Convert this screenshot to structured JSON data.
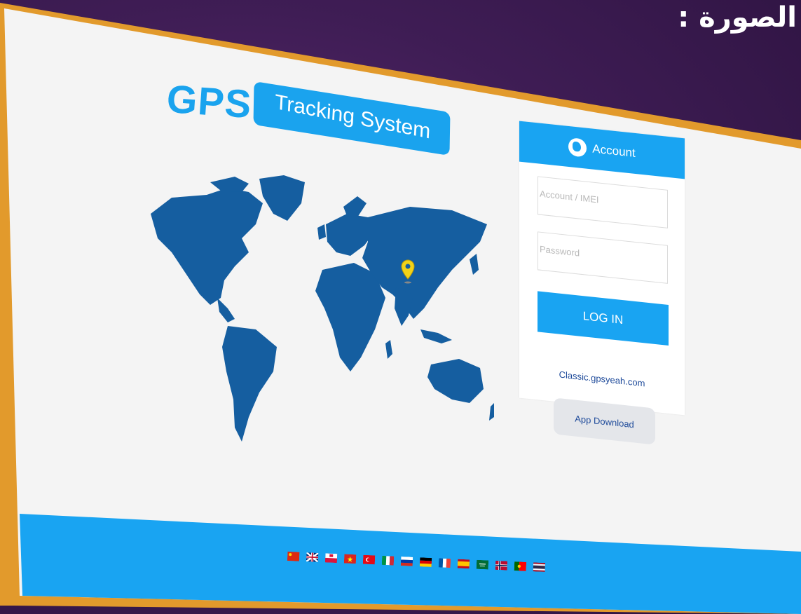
{
  "caption": "الصورة :",
  "logo": {
    "gps": "GPS",
    "tagline": "Tracking System"
  },
  "login": {
    "header": "Account",
    "account_placeholder": "Account / IMEI",
    "password_placeholder": "Password",
    "login_button": "LOG IN",
    "classic_link": "Classic.gpsyeah.com",
    "app_download": "App Download"
  },
  "map": {
    "marker_icon": "location-pin-icon"
  },
  "languages": [
    "flag-china-icon",
    "flag-uk-icon",
    "flag-poland-icon",
    "flag-vietnam-icon",
    "flag-turkey-icon",
    "flag-italy-icon",
    "flag-russia-icon",
    "flag-germany-icon",
    "flag-france-icon",
    "flag-spain-icon",
    "flag-saudi-icon",
    "flag-norway-icon",
    "flag-portugal-icon",
    "flag-thailand-icon"
  ],
  "colors": {
    "brand": "#19a4f2",
    "map": "#155ea0",
    "link": "#1e4a9a",
    "frame": "#e29a2c"
  }
}
